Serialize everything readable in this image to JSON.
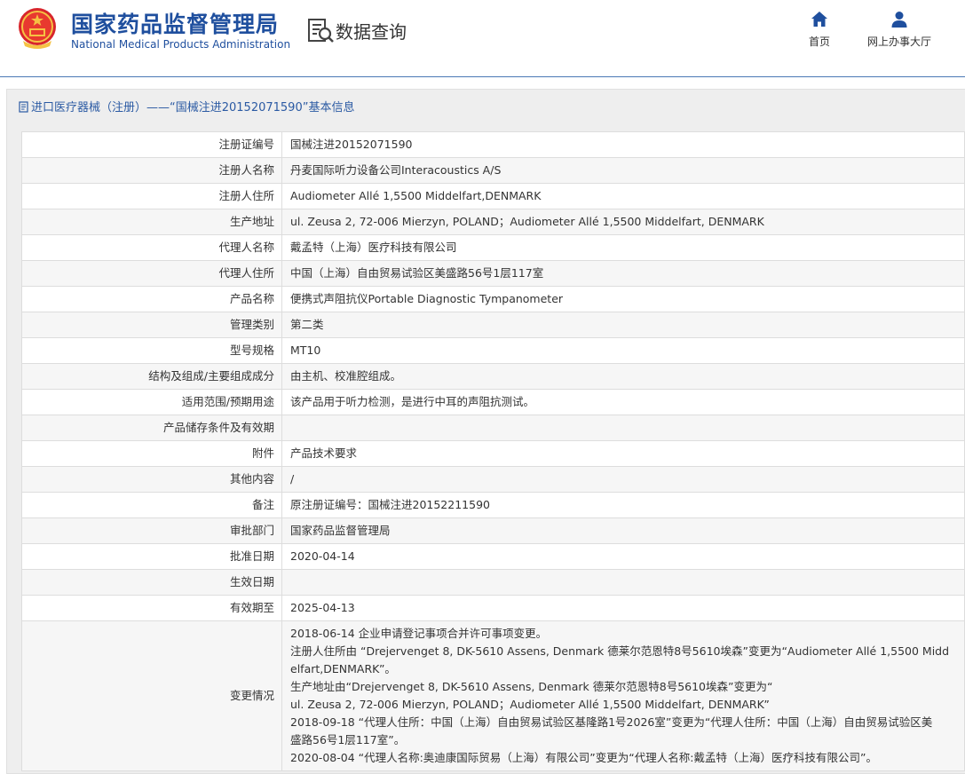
{
  "header": {
    "logo_cn": "国家药品监督管理局",
    "logo_en": "National Medical Products Administration",
    "query_title": "数据查询",
    "nav": [
      {
        "label": "首页",
        "icon": "home-icon"
      },
      {
        "label": "网上办事大厅",
        "icon": "user-icon"
      }
    ],
    "accent_color": "#1f4f9e"
  },
  "panel": {
    "title": "进口医疗器械（注册）——“国械注进20152071590”基本信息"
  },
  "rows": [
    {
      "label": "注册证编号",
      "value": "国械注进20152071590"
    },
    {
      "label": "注册人名称",
      "value": "丹麦国际听力设备公司Interacoustics A/S"
    },
    {
      "label": "注册人住所",
      "value": "Audiometer Allé 1,5500 Middelfart,DENMARK"
    },
    {
      "label": "生产地址",
      "value": "ul. Zeusa 2, 72-006 Mierzyn, POLAND；Audiometer Allé 1,5500 Middelfart, DENMARK"
    },
    {
      "label": "代理人名称",
      "value": "戴孟特（上海）医疗科技有限公司"
    },
    {
      "label": "代理人住所",
      "value": "中国（上海）自由贸易试验区美盛路56号1层117室"
    },
    {
      "label": "产品名称",
      "value": "便携式声阻抗仪Portable Diagnostic Tympanometer"
    },
    {
      "label": "管理类别",
      "value": "第二类"
    },
    {
      "label": "型号规格",
      "value": "MT10"
    },
    {
      "label": "结构及组成/主要组成成分",
      "value": "由主机、校准腔组成。"
    },
    {
      "label": "适用范围/预期用途",
      "value": "该产品用于听力检测，是进行中耳的声阻抗测试。"
    },
    {
      "label": "产品储存条件及有效期",
      "value": ""
    },
    {
      "label": "附件",
      "value": "产品技术要求"
    },
    {
      "label": "其他内容",
      "value": "/"
    },
    {
      "label": "备注",
      "value": "原注册证编号：国械注进20152211590"
    },
    {
      "label": "审批部门",
      "value": "国家药品监督管理局"
    },
    {
      "label": "批准日期",
      "value": "2020-04-14"
    },
    {
      "label": "生效日期",
      "value": ""
    },
    {
      "label": "有效期至",
      "value": "2025-04-13"
    }
  ],
  "change": {
    "label": "变更情况",
    "lines": [
      "2018-06-14 企业申请登记事项合并许可事项变更。",
      "注册人住所由 “Drejervenget 8, DK-5610 Assens, Denmark 德莱尔范恩特8号5610埃森”变更为“Audiometer Allé 1,5500 Midd",
      "elfart,DENMARK”。",
      "生产地址由“Drejervenget 8, DK-5610 Assens, Denmark 德莱尔范恩特8号5610埃森”变更为“",
      "ul. Zeusa 2, 72-006 Mierzyn, POLAND；Audiometer Allé 1,5500 Middelfart, DENMARK”",
      "2018-09-18 “代理人住所：中国（上海）自由贸易试验区基隆路1号2026室”变更为“代理人住所：中国（上海）自由贸易试验区美",
      "盛路56号1层117室”。",
      "2020-08-04 “代理人名称:奥迪康国际贸易（上海）有限公司”变更为“代理人名称:戴孟特（上海）医疗科技有限公司”。"
    ]
  }
}
